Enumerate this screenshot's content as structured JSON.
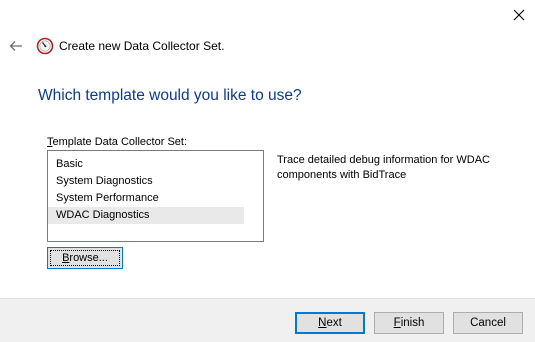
{
  "window": {
    "close_glyph": "✕"
  },
  "header": {
    "back_glyph": "←",
    "icon": "data-collector-icon",
    "title": "Create new Data Collector Set."
  },
  "page": {
    "heading": "Which template would you like to use?",
    "list_label_accel": "T",
    "list_label_rest": "emplate Data Collector Set:",
    "templates": [
      {
        "label": "Basic",
        "selected": false
      },
      {
        "label": "System Diagnostics",
        "selected": false
      },
      {
        "label": "System Performance",
        "selected": false
      },
      {
        "label": "WDAC Diagnostics",
        "selected": true
      }
    ],
    "description": "Trace detailed debug information for WDAC components with BidTrace",
    "browse_accel": "B",
    "browse_rest": "rowse..."
  },
  "footer": {
    "next_accel": "N",
    "next_rest": "ext",
    "finish_accel": "F",
    "finish_rest": "inish",
    "cancel_label": "Cancel"
  },
  "colors": {
    "heading": "#0b3a8f",
    "focus_border": "#0078d7",
    "footer_bg": "#f0f0f0",
    "selection_bg": "#e9e9e9"
  }
}
